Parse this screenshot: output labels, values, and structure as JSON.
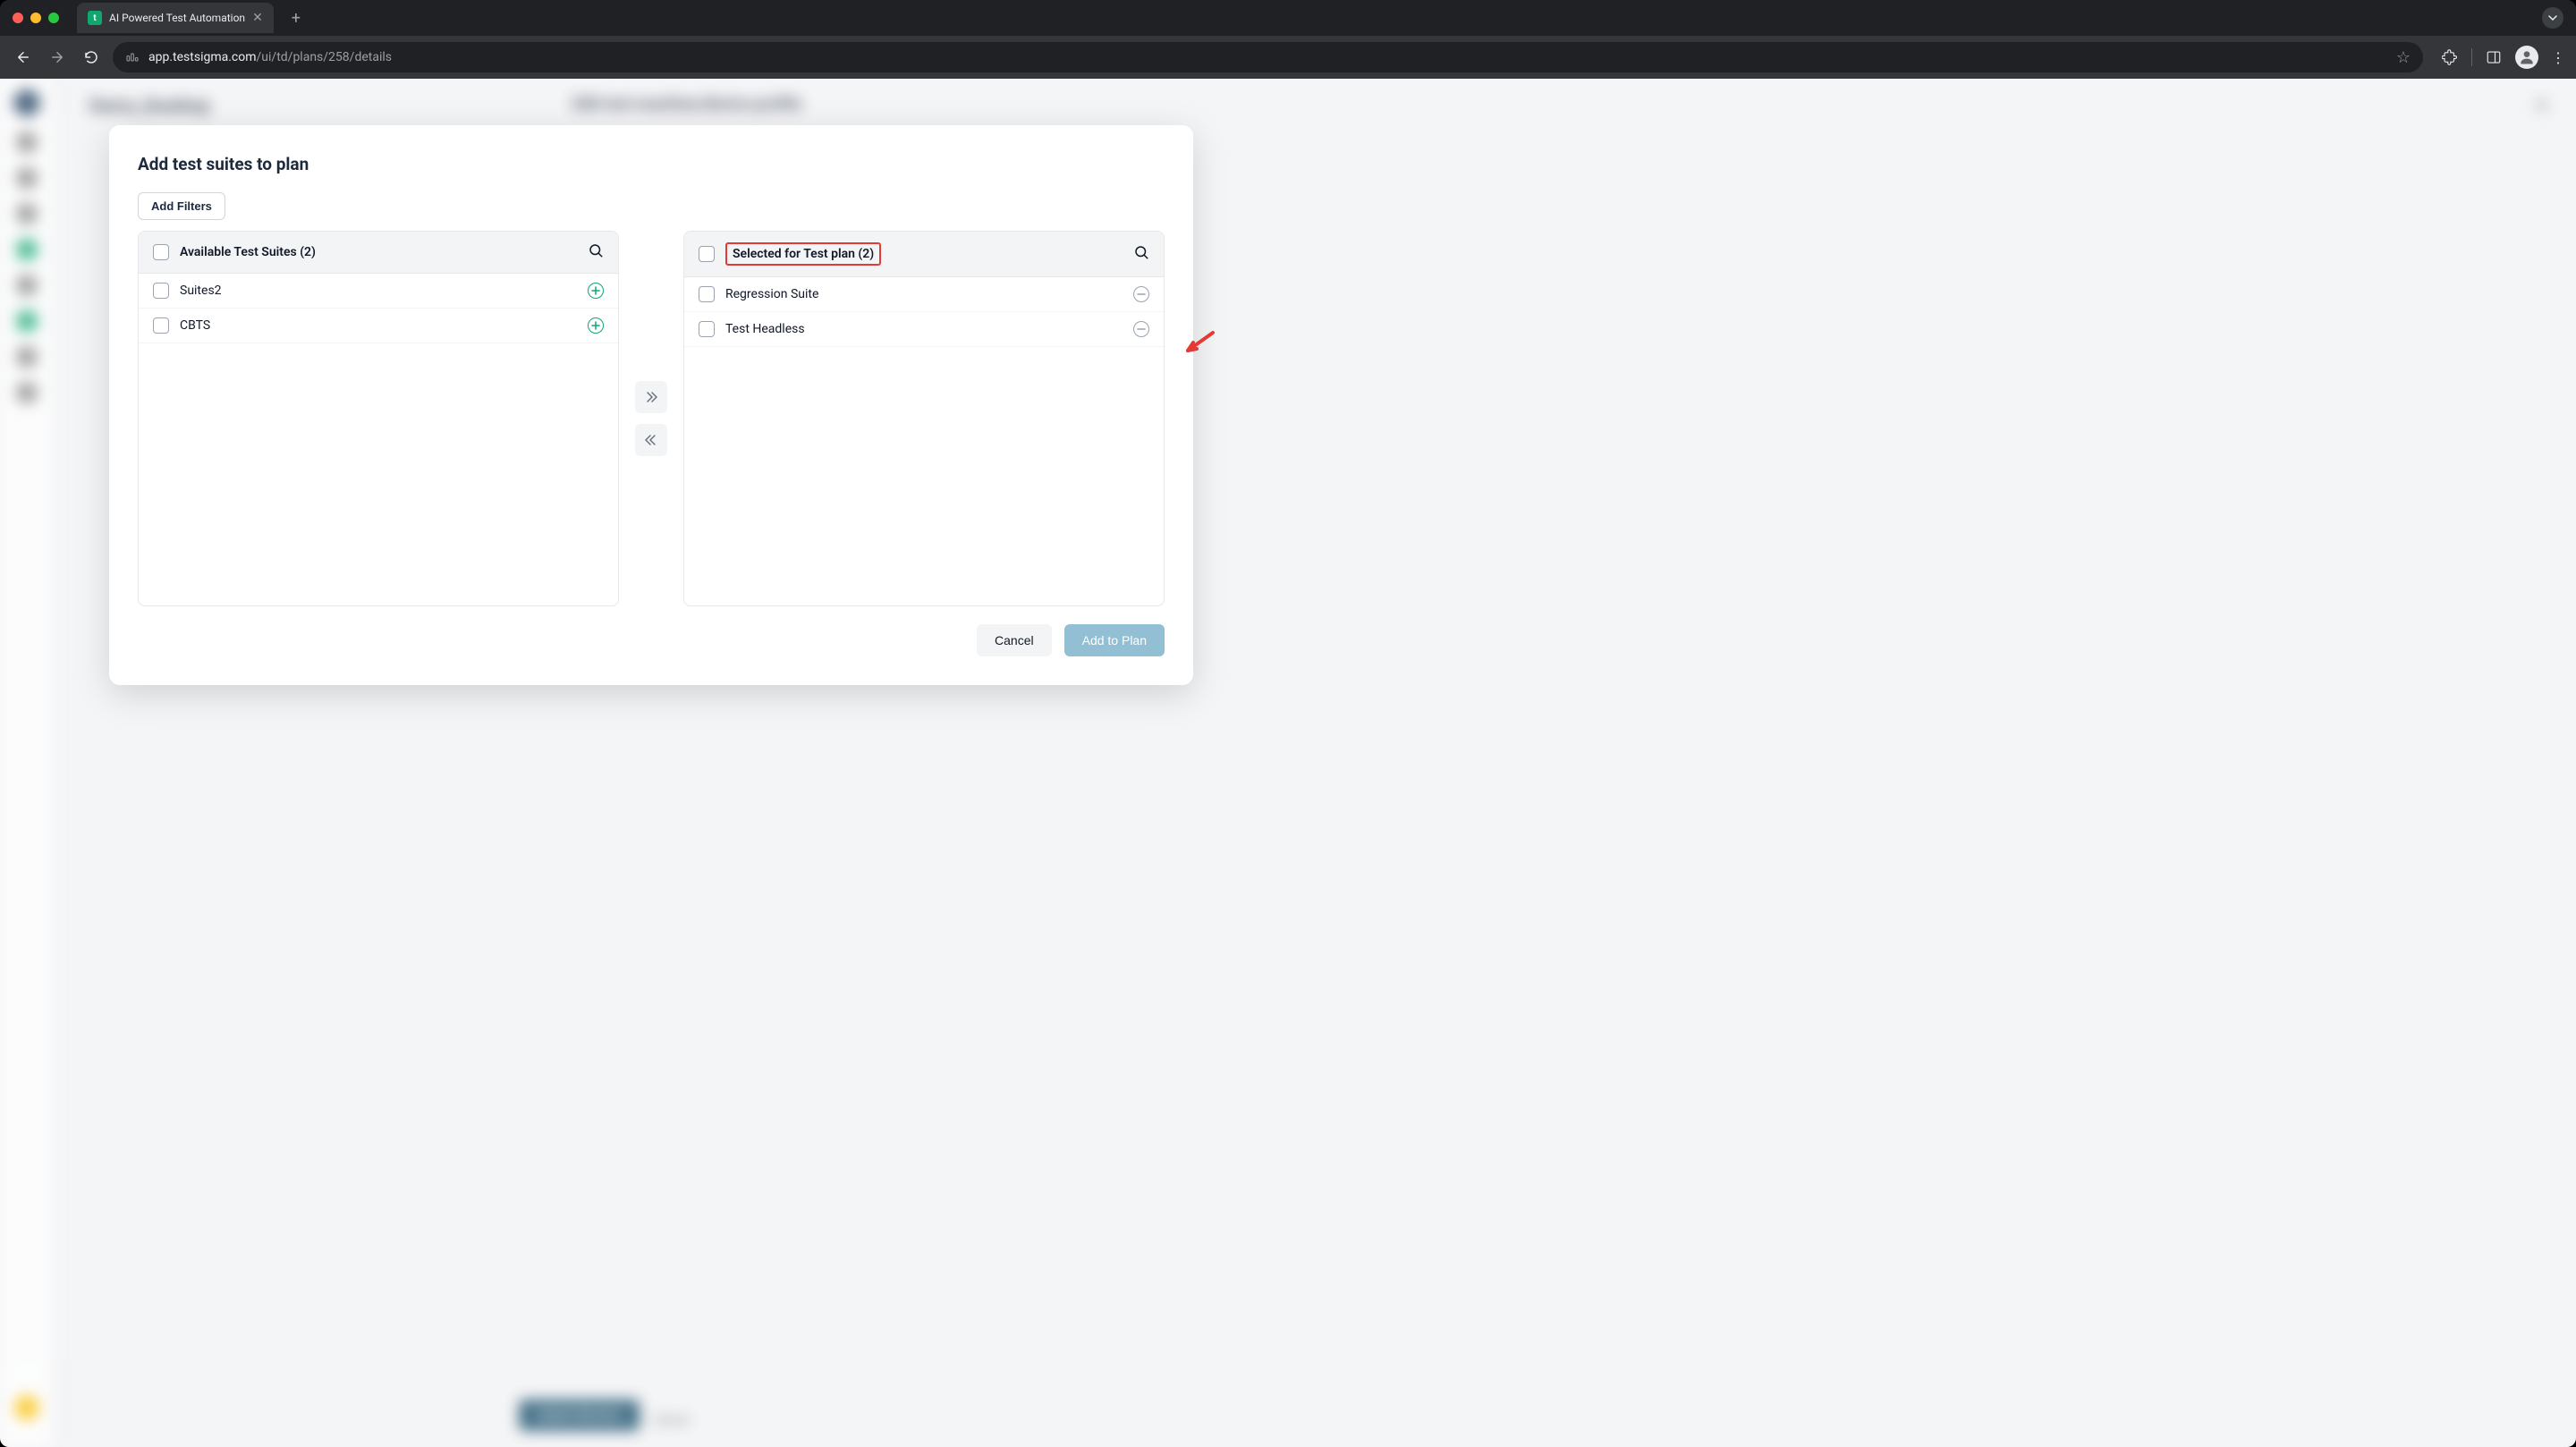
{
  "browser": {
    "tab_title": "AI Powered Test Automation",
    "url_host": "app.testsigma.com",
    "url_path": "/ui/td/plans/258/details"
  },
  "background": {
    "breadcrumb": "Demo_Desktop",
    "panel_title": "Edit test machine/device profile",
    "update_button": "Update Machine",
    "cancel_text": "Cancel"
  },
  "modal": {
    "title": "Add test suites to plan",
    "filters_button": "Add Filters",
    "available": {
      "header": "Available Test Suites (2)",
      "items": [
        "Suites2",
        "CBTS"
      ]
    },
    "selected": {
      "header": "Selected for Test plan (2)",
      "items": [
        "Regression Suite",
        "Test Headless"
      ]
    },
    "cancel": "Cancel",
    "add_to_plan": "Add to Plan"
  }
}
